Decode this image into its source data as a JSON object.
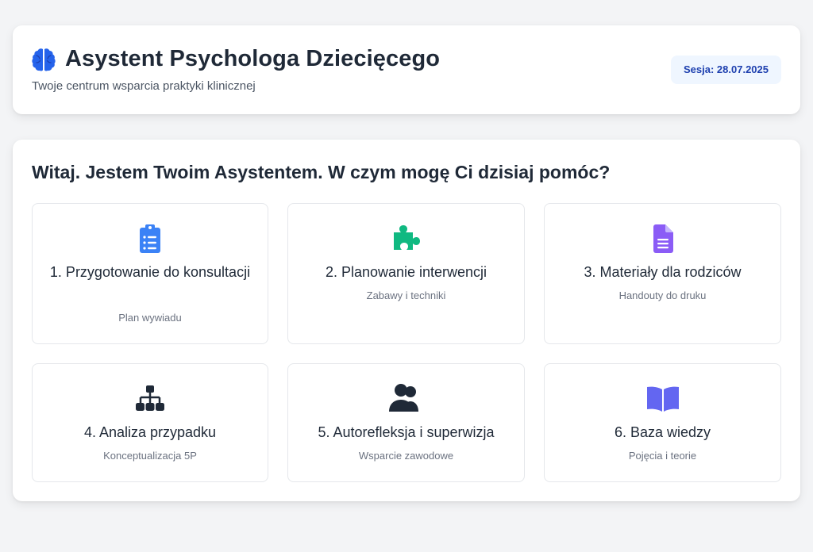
{
  "header": {
    "icon": "brain-icon",
    "title": "Asystent Psychologa Dziecięcego",
    "subtitle": "Twoje centrum wsparcia praktyki klinicznej",
    "session_badge": "Sesja: 28.07.2025"
  },
  "main": {
    "heading": "Witaj. Jestem Twoim Asystentem. W czym mogę Ci dzisiaj pomóc?",
    "tiles": [
      {
        "title": "1. Przygotowanie do konsultacji",
        "subtitle": "Plan wywiadu",
        "icon": "clipboard-list-icon",
        "color": "#3b82f6"
      },
      {
        "title": "2. Planowanie interwencji",
        "subtitle": "Zabawy i techniki",
        "icon": "puzzle-piece-icon",
        "color": "#10b981"
      },
      {
        "title": "3. Materiały dla rodziców",
        "subtitle": "Handouty do druku",
        "icon": "document-icon",
        "color": "#8b5cf6"
      },
      {
        "title": "4. Analiza przypadku",
        "subtitle": "Konceptualizacja 5P",
        "icon": "sitemap-icon",
        "color": "#1f2937"
      },
      {
        "title": "5. Autorefleksja i superwizja",
        "subtitle": "Wsparcie zawodowe",
        "icon": "users-icon",
        "color": "#1f2937"
      },
      {
        "title": "6. Baza wiedzy",
        "subtitle": "Pojęcia i teorie",
        "icon": "book-open-icon",
        "color": "#6366f1"
      }
    ]
  },
  "colors": {
    "background": "#f3f4f6",
    "card": "#ffffff",
    "badge_bg": "#eff6ff",
    "badge_text": "#1e40af",
    "brain": "#2563eb"
  }
}
